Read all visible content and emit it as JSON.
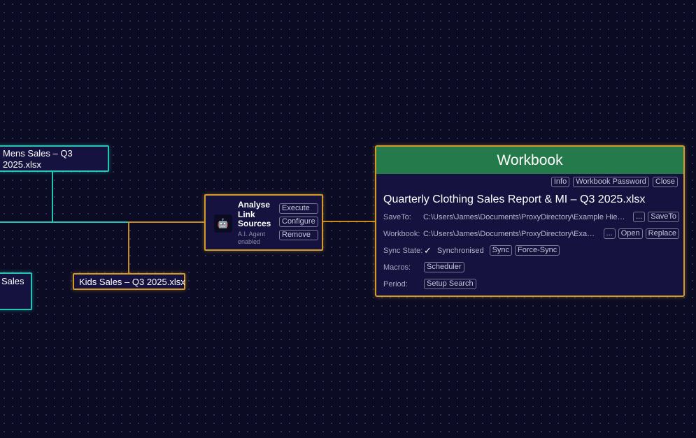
{
  "nodes": {
    "mens": {
      "label": "Mens Sales – Q3 2025.xlsx"
    },
    "sales_left": {
      "label": "Sales"
    },
    "kids": {
      "label": "Kids Sales – Q3 2025.xlsx"
    }
  },
  "agent": {
    "icon": "robot-icon",
    "title": "Analyse Link Sources",
    "subtitle": "A.I. Agent enabled",
    "buttons": {
      "execute": "Execute",
      "configure": "Configure",
      "remove": "Remove"
    }
  },
  "workbook": {
    "header": "Workbook",
    "top_buttons": {
      "info": "Info",
      "password": "Workbook Password",
      "close": "Close"
    },
    "title": "Quarterly Clothing Sales Report & MI – Q3 2025.xlsx",
    "saveto": {
      "label": "SaveTo:",
      "path": "C:\\Users\\James\\Documents\\ProxyDirectory\\Example Hierarchy\\Output",
      "browse": "...",
      "action": "SaveTo"
    },
    "workbook_row": {
      "label": "Workbook:",
      "path": "C:\\Users\\James\\Documents\\ProxyDirectory\\Example Hierarchy\\Quarterly",
      "browse": "...",
      "open": "Open",
      "replace": "Replace"
    },
    "sync": {
      "label": "Sync State:",
      "check": "✓",
      "status": "Synchronised",
      "sync_btn": "Sync",
      "force_btn": "Force-Sync"
    },
    "macros": {
      "label": "Macros:",
      "scheduler": "Scheduler"
    },
    "period": {
      "label": "Period:",
      "setup": "Setup Search"
    }
  },
  "colors": {
    "background": "#0b0c24",
    "teal": "#27c4b4",
    "amber": "#d39a2a",
    "header_green": "#247a4a",
    "node_fill": "#15123f"
  }
}
